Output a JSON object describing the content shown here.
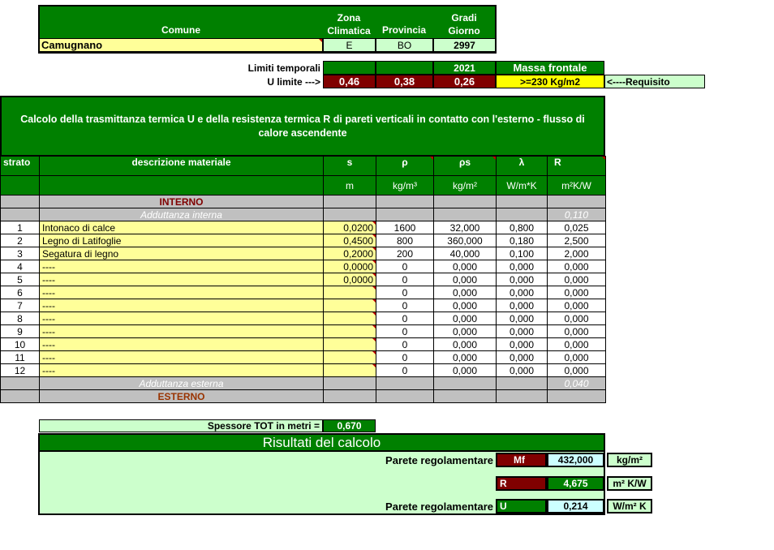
{
  "header": {
    "comune_label": "Comune",
    "zona_label_1": "Zona",
    "zona_label_2": "Climatica",
    "provincia_label": "Provincia",
    "gradi_label_1": "Gradi",
    "gradi_label_2": "Giorno",
    "comune_value": "Camugnano",
    "zona_value": "E",
    "provincia_value": "BO",
    "gradi_value": "2997"
  },
  "limits": {
    "label": "Limiti temporali",
    "year": "2021",
    "massa_label": "Massa frontale",
    "u_limite_label": "U limite --->",
    "values": [
      "0,46",
      "0,38",
      "0,26"
    ],
    "massa_value": ">=230 Kg/m2",
    "requisito": "<----Requisito"
  },
  "calc_title": "Calcolo della trasmittanza termica U e della resistenza termica R di pareti verticali in contatto con l'esterno - flusso di calore ascendente",
  "columns": {
    "strato": "strato",
    "descrizione": "descrizione materiale",
    "s": "s",
    "rho": "ρ",
    "rhos": "ρs",
    "lambda": "λ",
    "r": "R"
  },
  "units": {
    "s": "m",
    "rho": "kg/m³",
    "rhos": "kg/m²",
    "lambda": "W/m*K",
    "r": "m²K/W"
  },
  "interno_label": "INTERNO",
  "adduttanza_interna_label": "Adduttanza interna",
  "adduttanza_interna_value": "0,110",
  "rows": [
    {
      "n": "1",
      "desc": "Intonaco di calce",
      "s": "0,0200",
      "rho": "1600",
      "rhos": "32,000",
      "lambda": "0,800",
      "r": "0,025"
    },
    {
      "n": "2",
      "desc": "Legno di Latifoglie",
      "s": "0,4500",
      "rho": "800",
      "rhos": "360,000",
      "lambda": "0,180",
      "r": "2,500"
    },
    {
      "n": "3",
      "desc": "Segatura di legno",
      "s": "0,2000",
      "rho": "200",
      "rhos": "40,000",
      "lambda": "0,100",
      "r": "2,000"
    },
    {
      "n": "4",
      "desc": "----",
      "s": "0,0000",
      "rho": "0",
      "rhos": "0,000",
      "lambda": "0,000",
      "r": "0,000"
    },
    {
      "n": "5",
      "desc": "----",
      "s": "0,0000",
      "rho": "0",
      "rhos": "0,000",
      "lambda": "0,000",
      "r": "0,000"
    },
    {
      "n": "6",
      "desc": "----",
      "s": "",
      "rho": "0",
      "rhos": "0,000",
      "lambda": "0,000",
      "r": "0,000"
    },
    {
      "n": "7",
      "desc": "----",
      "s": "",
      "rho": "0",
      "rhos": "0,000",
      "lambda": "0,000",
      "r": "0,000"
    },
    {
      "n": "8",
      "desc": "----",
      "s": "",
      "rho": "0",
      "rhos": "0,000",
      "lambda": "0,000",
      "r": "0,000"
    },
    {
      "n": "9",
      "desc": "----",
      "s": "",
      "rho": "0",
      "rhos": "0,000",
      "lambda": "0,000",
      "r": "0,000"
    },
    {
      "n": "10",
      "desc": "----",
      "s": "",
      "rho": "0",
      "rhos": "0,000",
      "lambda": "0,000",
      "r": "0,000"
    },
    {
      "n": "11",
      "desc": "----",
      "s": "",
      "rho": "0",
      "rhos": "0,000",
      "lambda": "0,000",
      "r": "0,000"
    },
    {
      "n": "12",
      "desc": "----",
      "s": "",
      "rho": "0",
      "rhos": "0,000",
      "lambda": "0,000",
      "r": "0,000"
    }
  ],
  "adduttanza_esterna_label": "Adduttanza esterna",
  "adduttanza_esterna_value": "0,040",
  "esterno_label": "ESTERNO",
  "spessore_label": "Spessore TOT in metri =",
  "spessore_value": "0,670",
  "results": {
    "title": "Risultati del calcolo",
    "parete_label_1": "Parete regolamentare",
    "mf_label": "Mf",
    "mf_value": "432,000",
    "mf_unit": "kg/m²",
    "r_label": "R",
    "r_value": "4,675",
    "r_unit": "m² K/W",
    "parete_label_2": "Parete regolamentare",
    "u_label": "U",
    "u_value": "0,214",
    "u_unit": "W/m² K"
  },
  "colors": {
    "green": "#008000",
    "light_green": "#ccffcc",
    "dark_red": "#800000",
    "yellow": "#ffff99",
    "grey": "#c0c0c0"
  }
}
